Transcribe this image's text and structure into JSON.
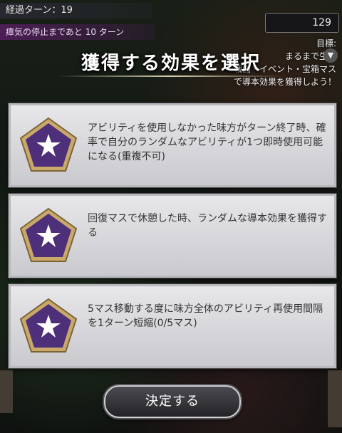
{
  "hud": {
    "turn_label": "経過ターン：19",
    "miasma_label": "瘴気の停止まであと 10 ターン",
    "counter_value": "129",
    "goal_label": "目標:",
    "goal_line1": "まるまで生存",
    "goal_line2": "戦闘・イベント・宝箱マス",
    "goal_line3": "で導本効果を獲得しよう！"
  },
  "dialog": {
    "title": "獲得する効果を選択",
    "options": [
      {
        "text": "アビリティを使用しなかった味方がターン終了時、確率で自分のランダムなアビリティが1つ即時使用可能になる(重複不可)",
        "icon": "star-pentagon-icon"
      },
      {
        "text": "回復マスで休憩した時、ランダムな導本効果を獲得する",
        "icon": "star-pentagon-icon"
      },
      {
        "text": "5マス移動する度に味方全体のアビリティ再使用間隔を1ターン短縮(0/5マス)",
        "icon": "star-pentagon-icon"
      }
    ],
    "confirm_label": "決定する"
  },
  "colors": {
    "pentagon": "#5a3a8a",
    "pentagon_border": "#c9a86a",
    "card": "#dcdce0"
  }
}
